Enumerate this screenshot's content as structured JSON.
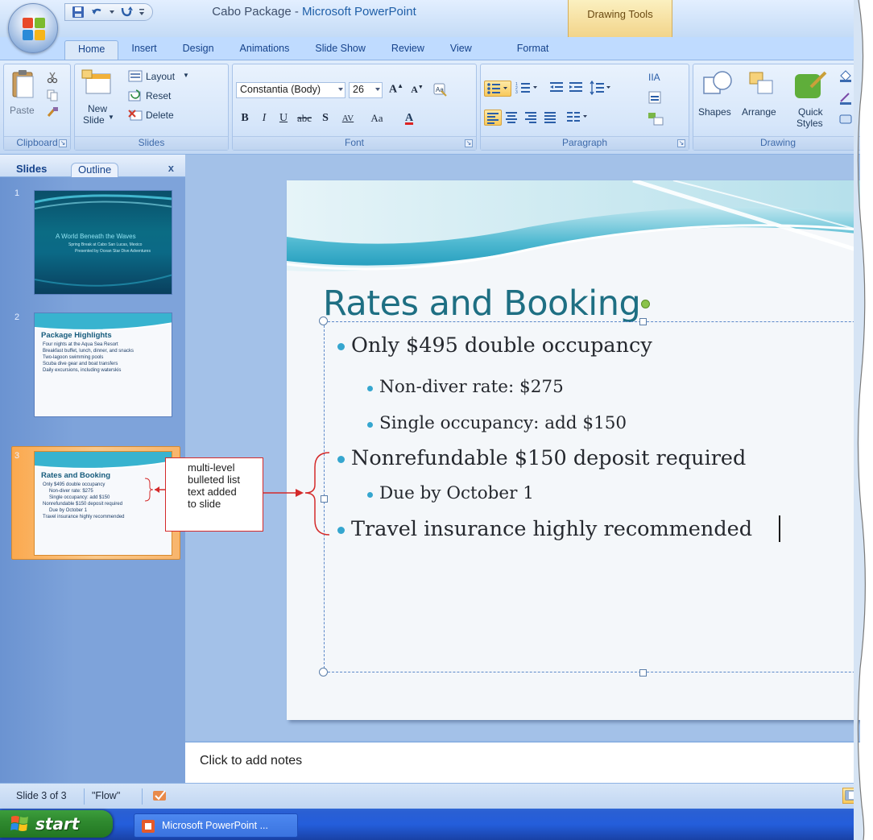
{
  "window": {
    "doc_name": "Cabo Package",
    "title_sep": " - ",
    "app_name": "Microsoft PowerPoint",
    "contextual_tab_group": "Drawing Tools"
  },
  "ribbon_tabs": [
    "Home",
    "Insert",
    "Design",
    "Animations",
    "Slide Show",
    "Review",
    "View",
    "Format"
  ],
  "ribbon": {
    "clipboard": {
      "label": "Clipboard",
      "paste": "Paste"
    },
    "slides": {
      "label": "Slides",
      "new_slide_1": "New",
      "new_slide_2": "Slide",
      "layout": "Layout",
      "reset": "Reset",
      "delete": "Delete"
    },
    "font": {
      "label": "Font",
      "font_name": "Constantia (Body)",
      "font_size": "26",
      "bold": "B",
      "italic": "I",
      "underline": "U",
      "strike": "abc",
      "shadow": "S",
      "spacing": "AV",
      "case": "Aa",
      "color": "A"
    },
    "paragraph": {
      "label": "Paragraph"
    },
    "drawing": {
      "label": "Drawing",
      "shapes": "Shapes",
      "arrange": "Arrange",
      "quick_1": "Quick",
      "quick_2": "Styles"
    }
  },
  "left_pane": {
    "tabs": {
      "slides": "Slides",
      "outline": "Outline",
      "close": "x"
    },
    "thumbnails": [
      {
        "number": "1",
        "title": "A World Beneath the Waves",
        "subtitle_lines": [
          "Spring Break at Cabo San Lucas, Mexico",
          "Presented by Ocean Star Dive Adventures"
        ]
      },
      {
        "number": "2",
        "title": "Package Highlights",
        "bullets": [
          "Four nights at the Aqua Sea Resort",
          "Breakfast buffet, lunch, dinner, and snacks",
          "Two-lagoon swimming pools",
          "Scuba dive gear and boat transfers",
          "Daily excursions, including waterskis"
        ]
      },
      {
        "number": "3",
        "title": "Rates and Booking",
        "bullets": [
          "Only $495 double occupancy",
          "Non-diver rate: $275",
          "Single occupancy: add $150",
          "Nonrefundable $150 deposit required",
          "Due by October 1",
          "Travel insurance highly recommended"
        ]
      }
    ]
  },
  "callout": {
    "lines": [
      "multi-level",
      "bulleted list",
      "text added",
      "to slide"
    ],
    "color": "#d42a2a"
  },
  "slide": {
    "title": "Rates and Booking",
    "bullets": [
      {
        "level": 1,
        "text": "Only $495 double occupancy"
      },
      {
        "level": 2,
        "text": "Non-diver rate: $275"
      },
      {
        "level": 2,
        "text": "Single occupancy: add $150"
      },
      {
        "level": 1,
        "text": "Nonrefundable $150 deposit required"
      },
      {
        "level": 2,
        "text": "Due by October 1"
      },
      {
        "level": 1,
        "text": "Travel insurance highly recommended"
      }
    ],
    "title_color": "#1e6f83",
    "bullet_color": "#35a6cf"
  },
  "notes": {
    "placeholder": "Click to add notes"
  },
  "status": {
    "slide_info": "Slide 3 of 3",
    "theme": "\"Flow\""
  },
  "taskbar": {
    "start": "start",
    "task_button": "Microsoft PowerPoint ..."
  }
}
